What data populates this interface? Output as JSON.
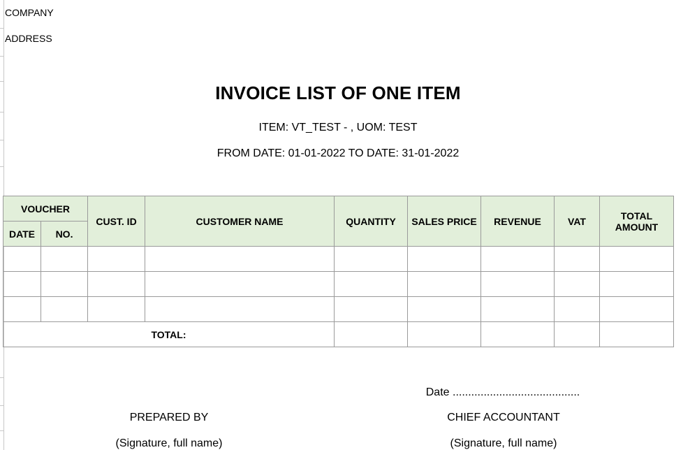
{
  "company": {
    "company_label": "COMPANY",
    "address_label": "ADDRESS"
  },
  "report": {
    "title": "INVOICE LIST OF ONE ITEM",
    "item_line": "ITEM: VT_TEST - , UOM: TEST",
    "date_range_line": "FROM DATE: 01-01-2022 TO DATE: 31-01-2022"
  },
  "table": {
    "headers": {
      "voucher": "VOUCHER",
      "date": "DATE",
      "no": "NO.",
      "cust_id": "CUST. ID",
      "customer_name": "CUSTOMER NAME",
      "quantity": "QUANTITY",
      "sales_price": "SALES PRICE",
      "revenue": "REVENUE",
      "vat": "VAT",
      "total_amount_line1": "TOTAL",
      "total_amount_line2": "AMOUNT"
    },
    "rows": [
      {
        "date": "",
        "no": "",
        "cust_id": "",
        "customer_name": "",
        "quantity": "",
        "sales_price": "",
        "revenue": "",
        "vat": "",
        "total_amount": ""
      },
      {
        "date": "",
        "no": "",
        "cust_id": "",
        "customer_name": "",
        "quantity": "",
        "sales_price": "",
        "revenue": "",
        "vat": "",
        "total_amount": ""
      },
      {
        "date": "",
        "no": "",
        "cust_id": "",
        "customer_name": "",
        "quantity": "",
        "sales_price": "",
        "revenue": "",
        "vat": "",
        "total_amount": ""
      }
    ],
    "total_label": "TOTAL:"
  },
  "signatures": {
    "date_line": "Date .........................................",
    "prepared_by": "PREPARED BY",
    "prepared_by_note": "(Signature, full name)",
    "chief_accountant": "CHIEF ACCOUNTANT",
    "chief_accountant_note": "(Signature, full name)"
  }
}
